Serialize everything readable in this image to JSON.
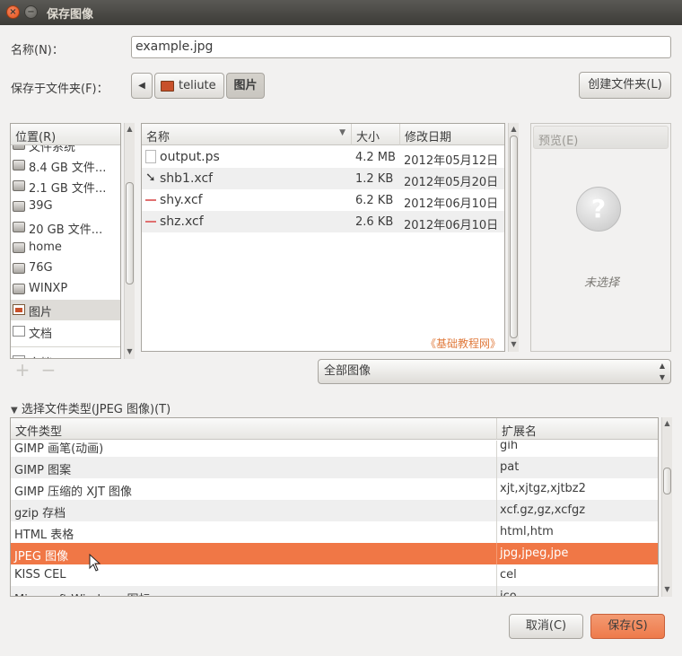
{
  "window": {
    "title": "保存图像"
  },
  "name_row": {
    "label": "名称(N)：",
    "value": "example.jpg"
  },
  "folder_row": {
    "label": "保存于文件夹(F)：",
    "crumbs": [
      "teliute",
      "图片"
    ],
    "create_folder": "创建文件夹(L)"
  },
  "places": {
    "header": "位置(R)",
    "items": [
      {
        "label": "文件系统",
        "icon": "drive-icon"
      },
      {
        "label": "8.4 GB 文件...",
        "icon": "drive-icon"
      },
      {
        "label": "2.1 GB 文件...",
        "icon": "drive-icon"
      },
      {
        "label": "39G",
        "icon": "drive-icon"
      },
      {
        "label": "20 GB 文件...",
        "icon": "drive-icon"
      },
      {
        "label": "home",
        "icon": "drive-icon"
      },
      {
        "label": "76G",
        "icon": "drive-icon"
      },
      {
        "label": "WINXP",
        "icon": "drive-icon"
      },
      {
        "label": "图片",
        "icon": "pictures-folder-icon"
      },
      {
        "label": "文档",
        "icon": "documents-folder-icon"
      },
      {
        "label": "文档",
        "icon": "documents-folder-icon"
      }
    ],
    "add": "+",
    "remove": "−"
  },
  "files": {
    "col_name": "名称",
    "col_size": "大小",
    "col_date": "修改日期",
    "rows": [
      {
        "name": "output.ps",
        "size": "4.2 MB",
        "date": "2012年05月12日"
      },
      {
        "name": "shb1.xcf",
        "size": "1.2 KB",
        "date": "2012年05月20日"
      },
      {
        "name": "shy.xcf",
        "size": "6.2 KB",
        "date": "2012年06月10日"
      },
      {
        "name": "shz.xcf",
        "size": "2.6 KB",
        "date": "2012年06月10日"
      }
    ],
    "watermark": "《基础教程网》"
  },
  "preview": {
    "header": "预览(E)",
    "none": "未选择"
  },
  "filter": {
    "selected": "全部图像"
  },
  "filetype": {
    "expander": "选择文件类型(JPEG 图像)(T)",
    "col_type": "文件类型",
    "col_ext": "扩展名",
    "rows": [
      {
        "type": "GIMP 画笔(动画)",
        "ext": "gih"
      },
      {
        "type": "GIMP 图案",
        "ext": "pat"
      },
      {
        "type": "GIMP 压缩的 XJT 图像",
        "ext": "xjt,xjtgz,xjtbz2"
      },
      {
        "type": "gzip 存档",
        "ext": "xcf.gz,gz,xcfgz"
      },
      {
        "type": "HTML 表格",
        "ext": "html,htm"
      },
      {
        "type": "JPEG 图像",
        "ext": "jpg,jpeg,jpe"
      },
      {
        "type": "KISS CEL",
        "ext": "cel"
      },
      {
        "type": "Microsoft Windows 图标",
        "ext": "ico"
      }
    ]
  },
  "buttons": {
    "cancel": "取消(C)",
    "save": "保存(S)"
  },
  "colors": {
    "accent": "#f07746",
    "titlebar": "#3c3b37",
    "close": "#e2531c"
  }
}
